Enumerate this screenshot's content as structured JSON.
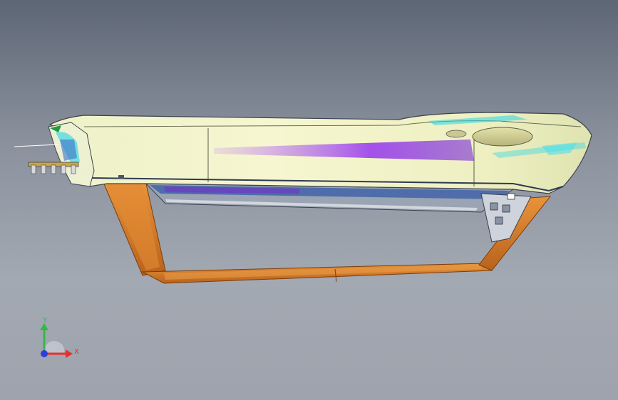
{
  "viewport": {
    "background_top": "#5d6675",
    "background_bottom": "#a3a9b2"
  },
  "model": {
    "name": "door-panel-assembly",
    "frame_color": "#d9822b",
    "panel_color": "#f3f1c8",
    "highlight_color": "#a44cf0",
    "accent_color": "#27d6e8"
  },
  "triad": {
    "x_label": "X",
    "y_label": "Y",
    "x_color": "#e0332d",
    "y_color": "#35b84a",
    "z_color": "#2d3fd6"
  }
}
